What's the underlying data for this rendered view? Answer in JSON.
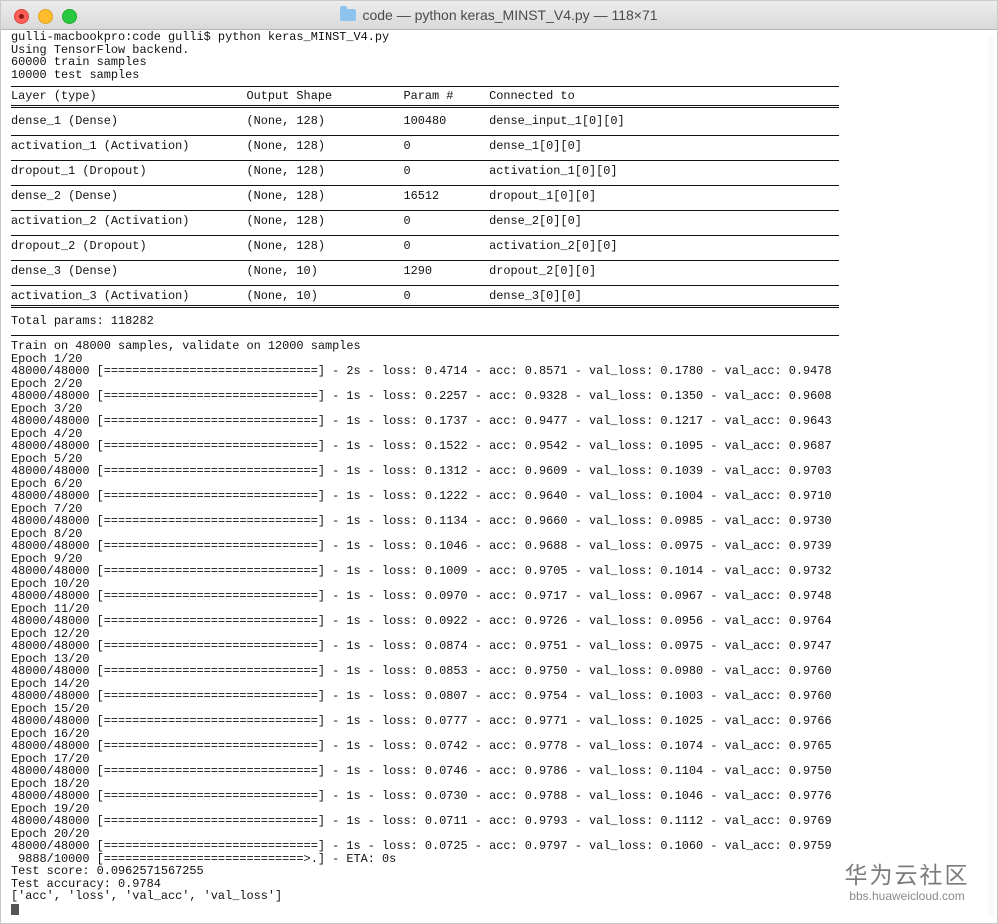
{
  "window": {
    "title": "code — python keras_MINST_V4.py — 118×71"
  },
  "terminal": {
    "prompt_line": "gulli-macbookpro:code gulli$ python keras_MINST_V4.py",
    "preamble": [
      "Using TensorFlow backend.",
      "60000 train samples",
      "10000 test samples"
    ],
    "summary_header": "Layer (type)                     Output Shape          Param #     Connected to",
    "layers": [
      "dense_1 (Dense)                  (None, 128)           100480      dense_input_1[0][0]",
      "activation_1 (Activation)        (None, 128)           0           dense_1[0][0]",
      "dropout_1 (Dropout)              (None, 128)           0           activation_1[0][0]",
      "dense_2 (Dense)                  (None, 128)           16512       dropout_1[0][0]",
      "activation_2 (Activation)        (None, 128)           0           dense_2[0][0]",
      "dropout_2 (Dropout)              (None, 128)           0           activation_2[0][0]",
      "dense_3 (Dense)                  (None, 10)            1290        dropout_2[0][0]",
      "activation_3 (Activation)        (None, 10)            0           dense_3[0][0]"
    ],
    "total_params": "Total params: 118282",
    "train_info": "Train on 48000 samples, validate on 12000 samples",
    "epochs": [
      {
        "label": "Epoch 1/20",
        "progress": "48000/48000 [==============================] - 2s - loss: 0.4714 - acc: 0.8571 - val_loss: 0.1780 - val_acc: 0.9478"
      },
      {
        "label": "Epoch 2/20",
        "progress": "48000/48000 [==============================] - 1s - loss: 0.2257 - acc: 0.9328 - val_loss: 0.1350 - val_acc: 0.9608"
      },
      {
        "label": "Epoch 3/20",
        "progress": "48000/48000 [==============================] - 1s - loss: 0.1737 - acc: 0.9477 - val_loss: 0.1217 - val_acc: 0.9643"
      },
      {
        "label": "Epoch 4/20",
        "progress": "48000/48000 [==============================] - 1s - loss: 0.1522 - acc: 0.9542 - val_loss: 0.1095 - val_acc: 0.9687"
      },
      {
        "label": "Epoch 5/20",
        "progress": "48000/48000 [==============================] - 1s - loss: 0.1312 - acc: 0.9609 - val_loss: 0.1039 - val_acc: 0.9703"
      },
      {
        "label": "Epoch 6/20",
        "progress": "48000/48000 [==============================] - 1s - loss: 0.1222 - acc: 0.9640 - val_loss: 0.1004 - val_acc: 0.9710"
      },
      {
        "label": "Epoch 7/20",
        "progress": "48000/48000 [==============================] - 1s - loss: 0.1134 - acc: 0.9660 - val_loss: 0.0985 - val_acc: 0.9730"
      },
      {
        "label": "Epoch 8/20",
        "progress": "48000/48000 [==============================] - 1s - loss: 0.1046 - acc: 0.9688 - val_loss: 0.0975 - val_acc: 0.9739"
      },
      {
        "label": "Epoch 9/20",
        "progress": "48000/48000 [==============================] - 1s - loss: 0.1009 - acc: 0.9705 - val_loss: 0.1014 - val_acc: 0.9732"
      },
      {
        "label": "Epoch 10/20",
        "progress": "48000/48000 [==============================] - 1s - loss: 0.0970 - acc: 0.9717 - val_loss: 0.0967 - val_acc: 0.9748"
      },
      {
        "label": "Epoch 11/20",
        "progress": "48000/48000 [==============================] - 1s - loss: 0.0922 - acc: 0.9726 - val_loss: 0.0956 - val_acc: 0.9764"
      },
      {
        "label": "Epoch 12/20",
        "progress": "48000/48000 [==============================] - 1s - loss: 0.0874 - acc: 0.9751 - val_loss: 0.0975 - val_acc: 0.9747"
      },
      {
        "label": "Epoch 13/20",
        "progress": "48000/48000 [==============================] - 1s - loss: 0.0853 - acc: 0.9750 - val_loss: 0.0980 - val_acc: 0.9760"
      },
      {
        "label": "Epoch 14/20",
        "progress": "48000/48000 [==============================] - 1s - loss: 0.0807 - acc: 0.9754 - val_loss: 0.1003 - val_acc: 0.9760"
      },
      {
        "label": "Epoch 15/20",
        "progress": "48000/48000 [==============================] - 1s - loss: 0.0777 - acc: 0.9771 - val_loss: 0.1025 - val_acc: 0.9766"
      },
      {
        "label": "Epoch 16/20",
        "progress": "48000/48000 [==============================] - 1s - loss: 0.0742 - acc: 0.9778 - val_loss: 0.1074 - val_acc: 0.9765"
      },
      {
        "label": "Epoch 17/20",
        "progress": "48000/48000 [==============================] - 1s - loss: 0.0746 - acc: 0.9786 - val_loss: 0.1104 - val_acc: 0.9750"
      },
      {
        "label": "Epoch 18/20",
        "progress": "48000/48000 [==============================] - 1s - loss: 0.0730 - acc: 0.9788 - val_loss: 0.1046 - val_acc: 0.9776"
      },
      {
        "label": "Epoch 19/20",
        "progress": "48000/48000 [==============================] - 1s - loss: 0.0711 - acc: 0.9793 - val_loss: 0.1112 - val_acc: 0.9769"
      },
      {
        "label": "Epoch 20/20",
        "progress": "48000/48000 [==============================] - 1s - loss: 0.0725 - acc: 0.9797 - val_loss: 0.1060 - val_acc: 0.9759"
      }
    ],
    "eval_progress": " 9888/10000 [============================>.] - ETA: 0s",
    "test_score": "Test score: 0.0962571567255",
    "test_accuracy": "Test accuracy: 0.9784",
    "history_keys": "['acc', 'loss', 'val_acc', 'val_loss']"
  },
  "watermark": {
    "logo_text": "华为云社区",
    "url": "bbs.huaweicloud.com"
  },
  "colors": {
    "terminal_text": "#111111",
    "close_button": "#ff5f57",
    "minimize_button": "#ffbd2e",
    "zoom_button": "#28c940"
  }
}
